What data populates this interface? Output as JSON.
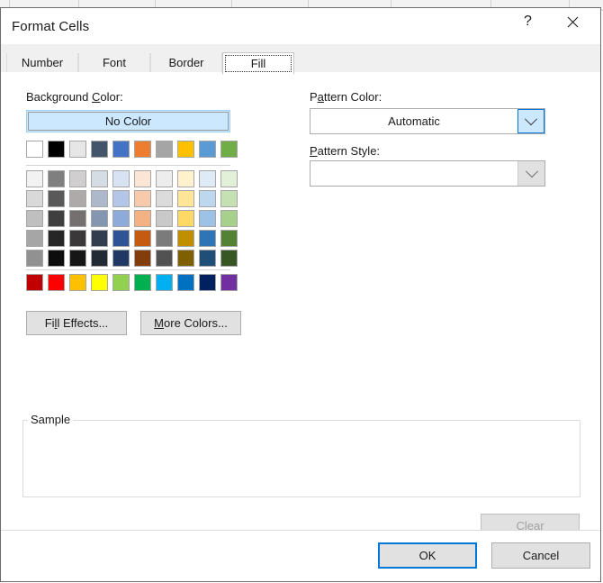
{
  "window": {
    "title": "Format Cells",
    "help_icon": "question-mark-icon",
    "close_icon": "close-x-icon"
  },
  "tabs": [
    {
      "label": "Number",
      "active": false
    },
    {
      "label": "Font",
      "active": false
    },
    {
      "label": "Border",
      "active": false
    },
    {
      "label": "Fill",
      "active": true
    }
  ],
  "fill_tab": {
    "background_color": {
      "label_pre": "Background ",
      "label_accel": "C",
      "label_post": "olor:",
      "no_color_button": "No Color",
      "theme_colors": [
        "#ffffff",
        "#000000",
        "#e7e6e6",
        "#44546a",
        "#4472c4",
        "#ed7d31",
        "#a5a5a5",
        "#ffc000",
        "#5b9bd5",
        "#70ad47"
      ],
      "tint_shade_rows": [
        [
          "#f2f2f2",
          "#7f7f7f",
          "#d0cece",
          "#d6dce4",
          "#d9e2f3",
          "#fbe5d5",
          "#ededed",
          "#fff2cc",
          "#deebf6",
          "#e2efd9"
        ],
        [
          "#d9d9d9",
          "#595959",
          "#aeaaaa",
          "#adb9ca",
          "#b4c6e7",
          "#f7caac",
          "#dbdbdb",
          "#ffe598",
          "#bdd7ee",
          "#c5e0b3"
        ],
        [
          "#bfbfbf",
          "#3f3f3f",
          "#757070",
          "#8496b0",
          "#8eaadb",
          "#f4b183",
          "#c9c9c9",
          "#ffd965",
          "#9cc3e5",
          "#a8d08d"
        ],
        [
          "#a6a6a6",
          "#262626",
          "#3a3838",
          "#323e4f",
          "#2f5496",
          "#c55a11",
          "#7b7b7b",
          "#bf8f00",
          "#2e75b5",
          "#538135"
        ],
        [
          "#919191",
          "#0d0d0d",
          "#171616",
          "#222a35",
          "#1f3864",
          "#833c0b",
          "#525252",
          "#7f6000",
          "#1f4e79",
          "#375623"
        ]
      ],
      "standard_colors": [
        "#c00000",
        "#ff0000",
        "#ffc000",
        "#ffff00",
        "#92d050",
        "#00b050",
        "#00b0f0",
        "#0070c0",
        "#002060",
        "#7030a0"
      ]
    },
    "fill_effects_button": {
      "pre": "Fi",
      "accel": "l",
      "post": "l Effects..."
    },
    "more_colors_button": {
      "accel": "M",
      "post": "ore Colors..."
    },
    "pattern_color": {
      "label_pre": "P",
      "label_accel": "a",
      "label_post": "ttern Color:",
      "value": "Automatic",
      "chevron_icon": "chevron-down-icon"
    },
    "pattern_style": {
      "label_accel": "P",
      "label_post": "attern Style:",
      "value": "",
      "chevron_icon": "chevron-down-icon"
    },
    "sample": {
      "legend": "Sample",
      "content": ""
    },
    "clear_button": {
      "label": "Clear",
      "enabled": false
    }
  },
  "footer": {
    "ok_button": "OK",
    "cancel_button": "Cancel"
  },
  "colors": {
    "accent": "#0078d7",
    "highlight_fill": "#cce8ff",
    "button_face": "#e1e1e1",
    "dialog_bg": "#ffffff",
    "tabstrip_bg": "#f0f0f0",
    "disabled_text": "#a0a0a0"
  },
  "sheet_strip": {
    "column_separators": [
      10,
      87,
      172,
      257,
      342,
      434,
      545,
      632
    ]
  }
}
